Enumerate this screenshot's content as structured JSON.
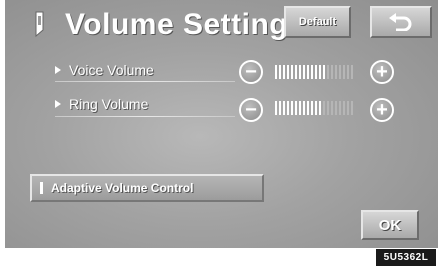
{
  "header": {
    "title": "Volume Settings",
    "default_label": "Default",
    "back_icon": "back-arrow-icon"
  },
  "rows": [
    {
      "label": "Voice Volume",
      "level": 0.65
    },
    {
      "label": "Ring Volume",
      "level": 0.6
    }
  ],
  "minus_symbol": "−",
  "plus_symbol": "+",
  "adaptive": {
    "label": "Adaptive Volume Control"
  },
  "ok_label": "OK",
  "image_code": "5U5362L",
  "colors": {
    "background": "#a0a0a0",
    "text": "#ffffff"
  }
}
